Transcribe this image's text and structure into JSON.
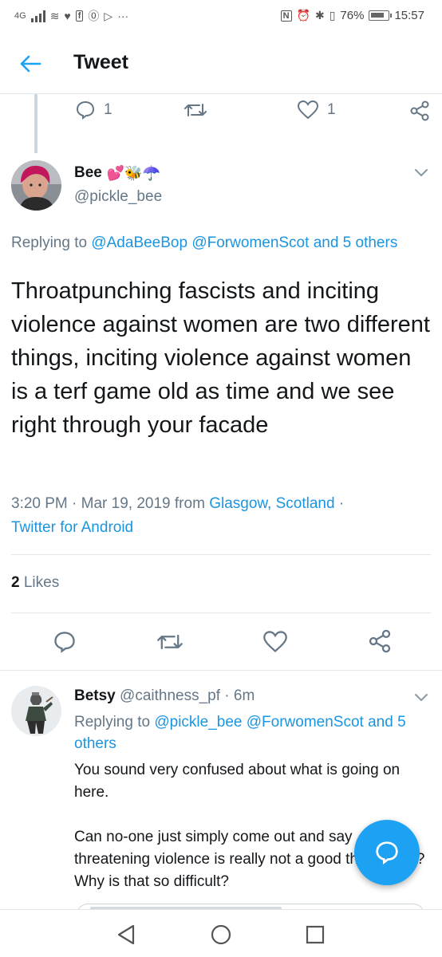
{
  "status_bar": {
    "network": "4G",
    "battery_percent": "76%",
    "time": "15:57",
    "more": "···"
  },
  "header": {
    "title": "Tweet"
  },
  "previous_tweet": {
    "reply_count": "1",
    "like_count": "1"
  },
  "main_tweet": {
    "author_name": "Bee",
    "author_emoji": "💕🐝☂️",
    "author_handle": "@pickle_bee",
    "replying_prefix": "Replying to",
    "replying_users": [
      "@AdaBeeBop",
      "@ForwomenScot"
    ],
    "replying_suffix": "and 5 others",
    "text": "Throatpunching fascists and inciting violence against women are two different things, inciting violence against women is a terf game old as time and we see right through your facade",
    "time": "3:20 PM",
    "date": "Mar 19, 2019",
    "from_label": "from",
    "location": "Glasgow, Scotland",
    "client": "Twitter for Android",
    "likes_count": "2",
    "likes_label": "Likes"
  },
  "reply_tweet": {
    "author_name": "Betsy",
    "author_handle": "@caithness_pf",
    "age": "6m",
    "replying_prefix": "Replying to",
    "replying_users": [
      "@pickle_bee",
      "@ForwomenScot"
    ],
    "replying_suffix": "and 5 others",
    "paragraph_1": "You sound very confused about what is going on here.",
    "paragraph_2": "Can no-one just simply come out and say threatening violence is really not a good thing to do? Why is that so difficult?"
  },
  "colors": {
    "accent": "#1da1f2",
    "link": "#1b95e0",
    "muted": "#657786",
    "divider": "#e1e8ed"
  },
  "icons": {
    "back": "arrow-left-icon",
    "reply": "speech-bubble-icon",
    "retweet": "retweet-icon",
    "like": "heart-icon",
    "share": "share-icon",
    "compose": "compose-reply-icon"
  }
}
